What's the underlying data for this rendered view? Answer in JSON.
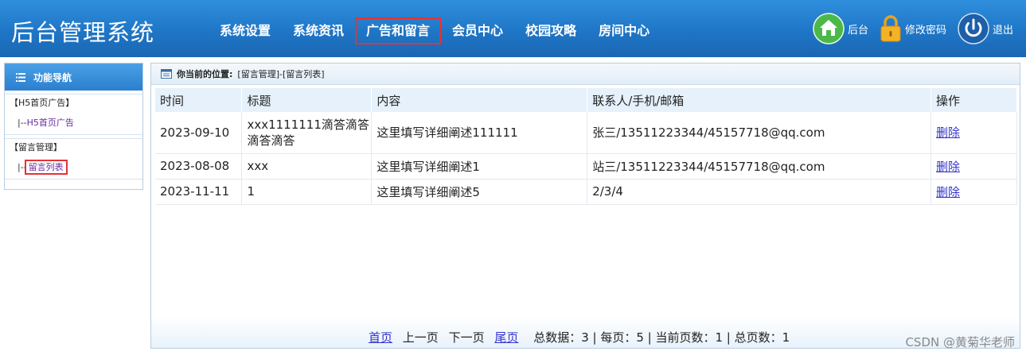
{
  "header": {
    "logo": "后台管理系统",
    "nav": [
      {
        "label": "系统设置",
        "active": false
      },
      {
        "label": "系统资讯",
        "active": false
      },
      {
        "label": "广告和留言",
        "active": true
      },
      {
        "label": "会员中心",
        "active": false
      },
      {
        "label": "校园攻略",
        "active": false
      },
      {
        "label": "房间中心",
        "active": false
      }
    ],
    "tools": {
      "home_label": "后台",
      "password_label": "修改密码",
      "logout_label": "退出"
    }
  },
  "sidebar": {
    "title": "功能导航",
    "groups": [
      {
        "label": "【H5首页广告】",
        "prefix": "|--",
        "link": "H5首页广告"
      },
      {
        "label": "【留言管理】",
        "prefix": "|--",
        "link": "留言列表"
      }
    ]
  },
  "main": {
    "breadcrumb_prefix": "你当前的位置:",
    "breadcrumb_path": "[留言管理]-[留言列表]",
    "table": {
      "headers": [
        "时间",
        "标题",
        "内容",
        "联系人/手机/邮箱",
        "操作"
      ],
      "rows": [
        {
          "time": "2023-09-10",
          "title": "xxx1111111滴答滴答滴答滴答",
          "content": "这里填写详细阐述111111",
          "contact": "张三/13511223344/45157718@qq.com",
          "action": "删除"
        },
        {
          "time": "2023-08-08",
          "title": "xxx",
          "content": "这里填写详细阐述1",
          "contact": "站三/13511223344/45157718@qq.com",
          "action": "删除"
        },
        {
          "time": "2023-11-11",
          "title": "1",
          "content": "这里填写详细阐述5",
          "contact": "2/3/4",
          "action": "删除"
        }
      ]
    },
    "pager": {
      "first": "首页",
      "prev": "上一页",
      "next": "下一页",
      "last": "尾页",
      "summary": "总数据：3 | 每页：5 | 当前页数：1 | 总页数：1"
    }
  },
  "watermark": "CSDN @黄菊华老师",
  "colors": {
    "header_bg": "#1f76c6",
    "active_outline": "#e53333",
    "link": "#3333cc"
  }
}
